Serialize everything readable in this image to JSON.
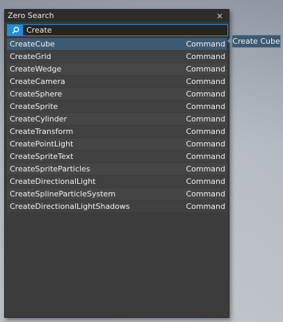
{
  "window": {
    "title": "Zero Search",
    "close_glyph": "×"
  },
  "search": {
    "value": "Create",
    "icon": "search-icon"
  },
  "results": [
    {
      "name": "CreateCube",
      "type": "Command",
      "selected": true
    },
    {
      "name": "CreateGrid",
      "type": "Command"
    },
    {
      "name": "CreateWedge",
      "type": "Command"
    },
    {
      "name": "CreateCamera",
      "type": "Command"
    },
    {
      "name": "CreateSphere",
      "type": "Command"
    },
    {
      "name": "CreateSprite",
      "type": "Command"
    },
    {
      "name": "CreateCylinder",
      "type": "Command"
    },
    {
      "name": "CreateTransform",
      "type": "Command"
    },
    {
      "name": "CreatePointLight",
      "type": "Command"
    },
    {
      "name": "CreateSpriteText",
      "type": "Command"
    },
    {
      "name": "CreateSpriteParticles",
      "type": "Command"
    },
    {
      "name": "CreateDirectionalLight",
      "type": "Command"
    },
    {
      "name": "CreateSplineParticleSystem",
      "type": "Command"
    },
    {
      "name": "CreateDirectionalLightShadows",
      "type": "Command"
    }
  ],
  "tooltip": {
    "text": "Create Cube"
  },
  "colors": {
    "accent": "#1e8fd9",
    "selection": "#3e5a72",
    "panel": "#3c3c3c",
    "row": "#464646"
  }
}
